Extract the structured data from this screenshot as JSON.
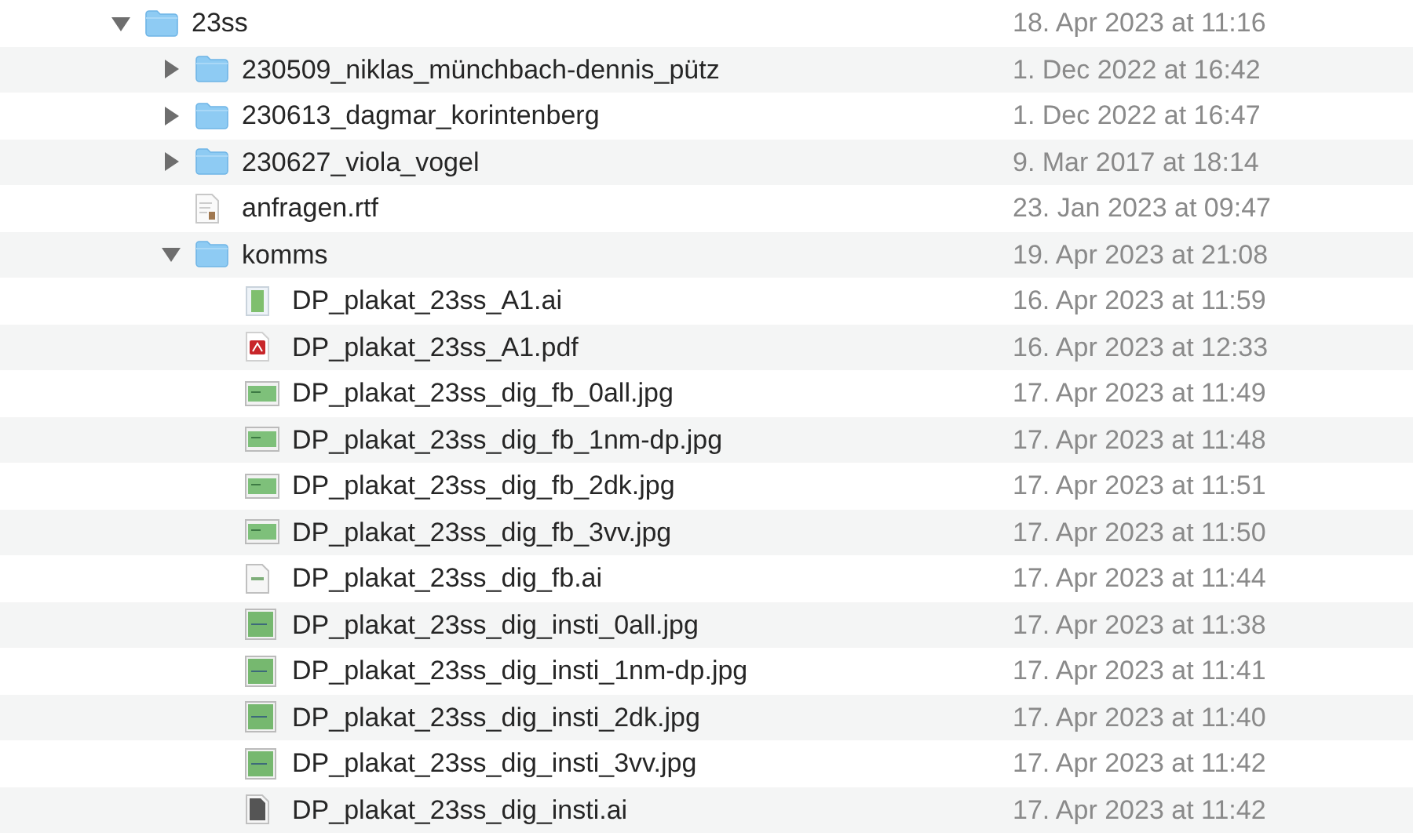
{
  "files": [
    {
      "name": "23ss",
      "date": "18. Apr 2023 at 11:16",
      "kind": "folder",
      "expanded": true,
      "children": [
        {
          "name": "230509_niklas_münchbach-dennis_pütz",
          "date": "1. Dec 2022 at 16:42",
          "kind": "folder",
          "expanded": false
        },
        {
          "name": "230613_dagmar_korintenberg",
          "date": "1. Dec 2022 at 16:47",
          "kind": "folder",
          "expanded": false
        },
        {
          "name": "230627_viola_vogel",
          "date": "9. Mar 2017 at 18:14",
          "kind": "folder",
          "expanded": false
        },
        {
          "name": "anfragen.rtf",
          "date": "23. Jan 2023 at 09:47",
          "kind": "text"
        },
        {
          "name": "komms",
          "date": "19. Apr 2023 at 21:08",
          "kind": "folder",
          "expanded": true,
          "children": [
            {
              "name": "DP_plakat_23ss_A1.ai",
              "date": "16. Apr 2023 at 11:59",
              "kind": "artwork"
            },
            {
              "name": "DP_plakat_23ss_A1.pdf",
              "date": "16. Apr 2023 at 12:33",
              "kind": "pdf"
            },
            {
              "name": "DP_plakat_23ss_dig_fb_0all.jpg",
              "date": "17. Apr 2023 at 11:49",
              "kind": "wide-image"
            },
            {
              "name": "DP_plakat_23ss_dig_fb_1nm-dp.jpg",
              "date": "17. Apr 2023 at 11:48",
              "kind": "wide-image"
            },
            {
              "name": "DP_plakat_23ss_dig_fb_2dk.jpg",
              "date": "17. Apr 2023 at 11:51",
              "kind": "wide-image"
            },
            {
              "name": "DP_plakat_23ss_dig_fb_3vv.jpg",
              "date": "17. Apr 2023 at 11:50",
              "kind": "wide-image"
            },
            {
              "name": "DP_plakat_23ss_dig_fb.ai",
              "date": "17. Apr 2023 at 11:44",
              "kind": "plain-document"
            },
            {
              "name": "DP_plakat_23ss_dig_insti_0all.jpg",
              "date": "17. Apr 2023 at 11:38",
              "kind": "square-image"
            },
            {
              "name": "DP_plakat_23ss_dig_insti_1nm-dp.jpg",
              "date": "17. Apr 2023 at 11:41",
              "kind": "square-image"
            },
            {
              "name": "DP_plakat_23ss_dig_insti_2dk.jpg",
              "date": "17. Apr 2023 at 11:40",
              "kind": "square-image"
            },
            {
              "name": "DP_plakat_23ss_dig_insti_3vv.jpg",
              "date": "17. Apr 2023 at 11:42",
              "kind": "square-image"
            },
            {
              "name": "DP_plakat_23ss_dig_insti.ai",
              "date": "17. Apr 2023 at 11:42",
              "kind": "dark-document"
            }
          ]
        }
      ]
    }
  ]
}
